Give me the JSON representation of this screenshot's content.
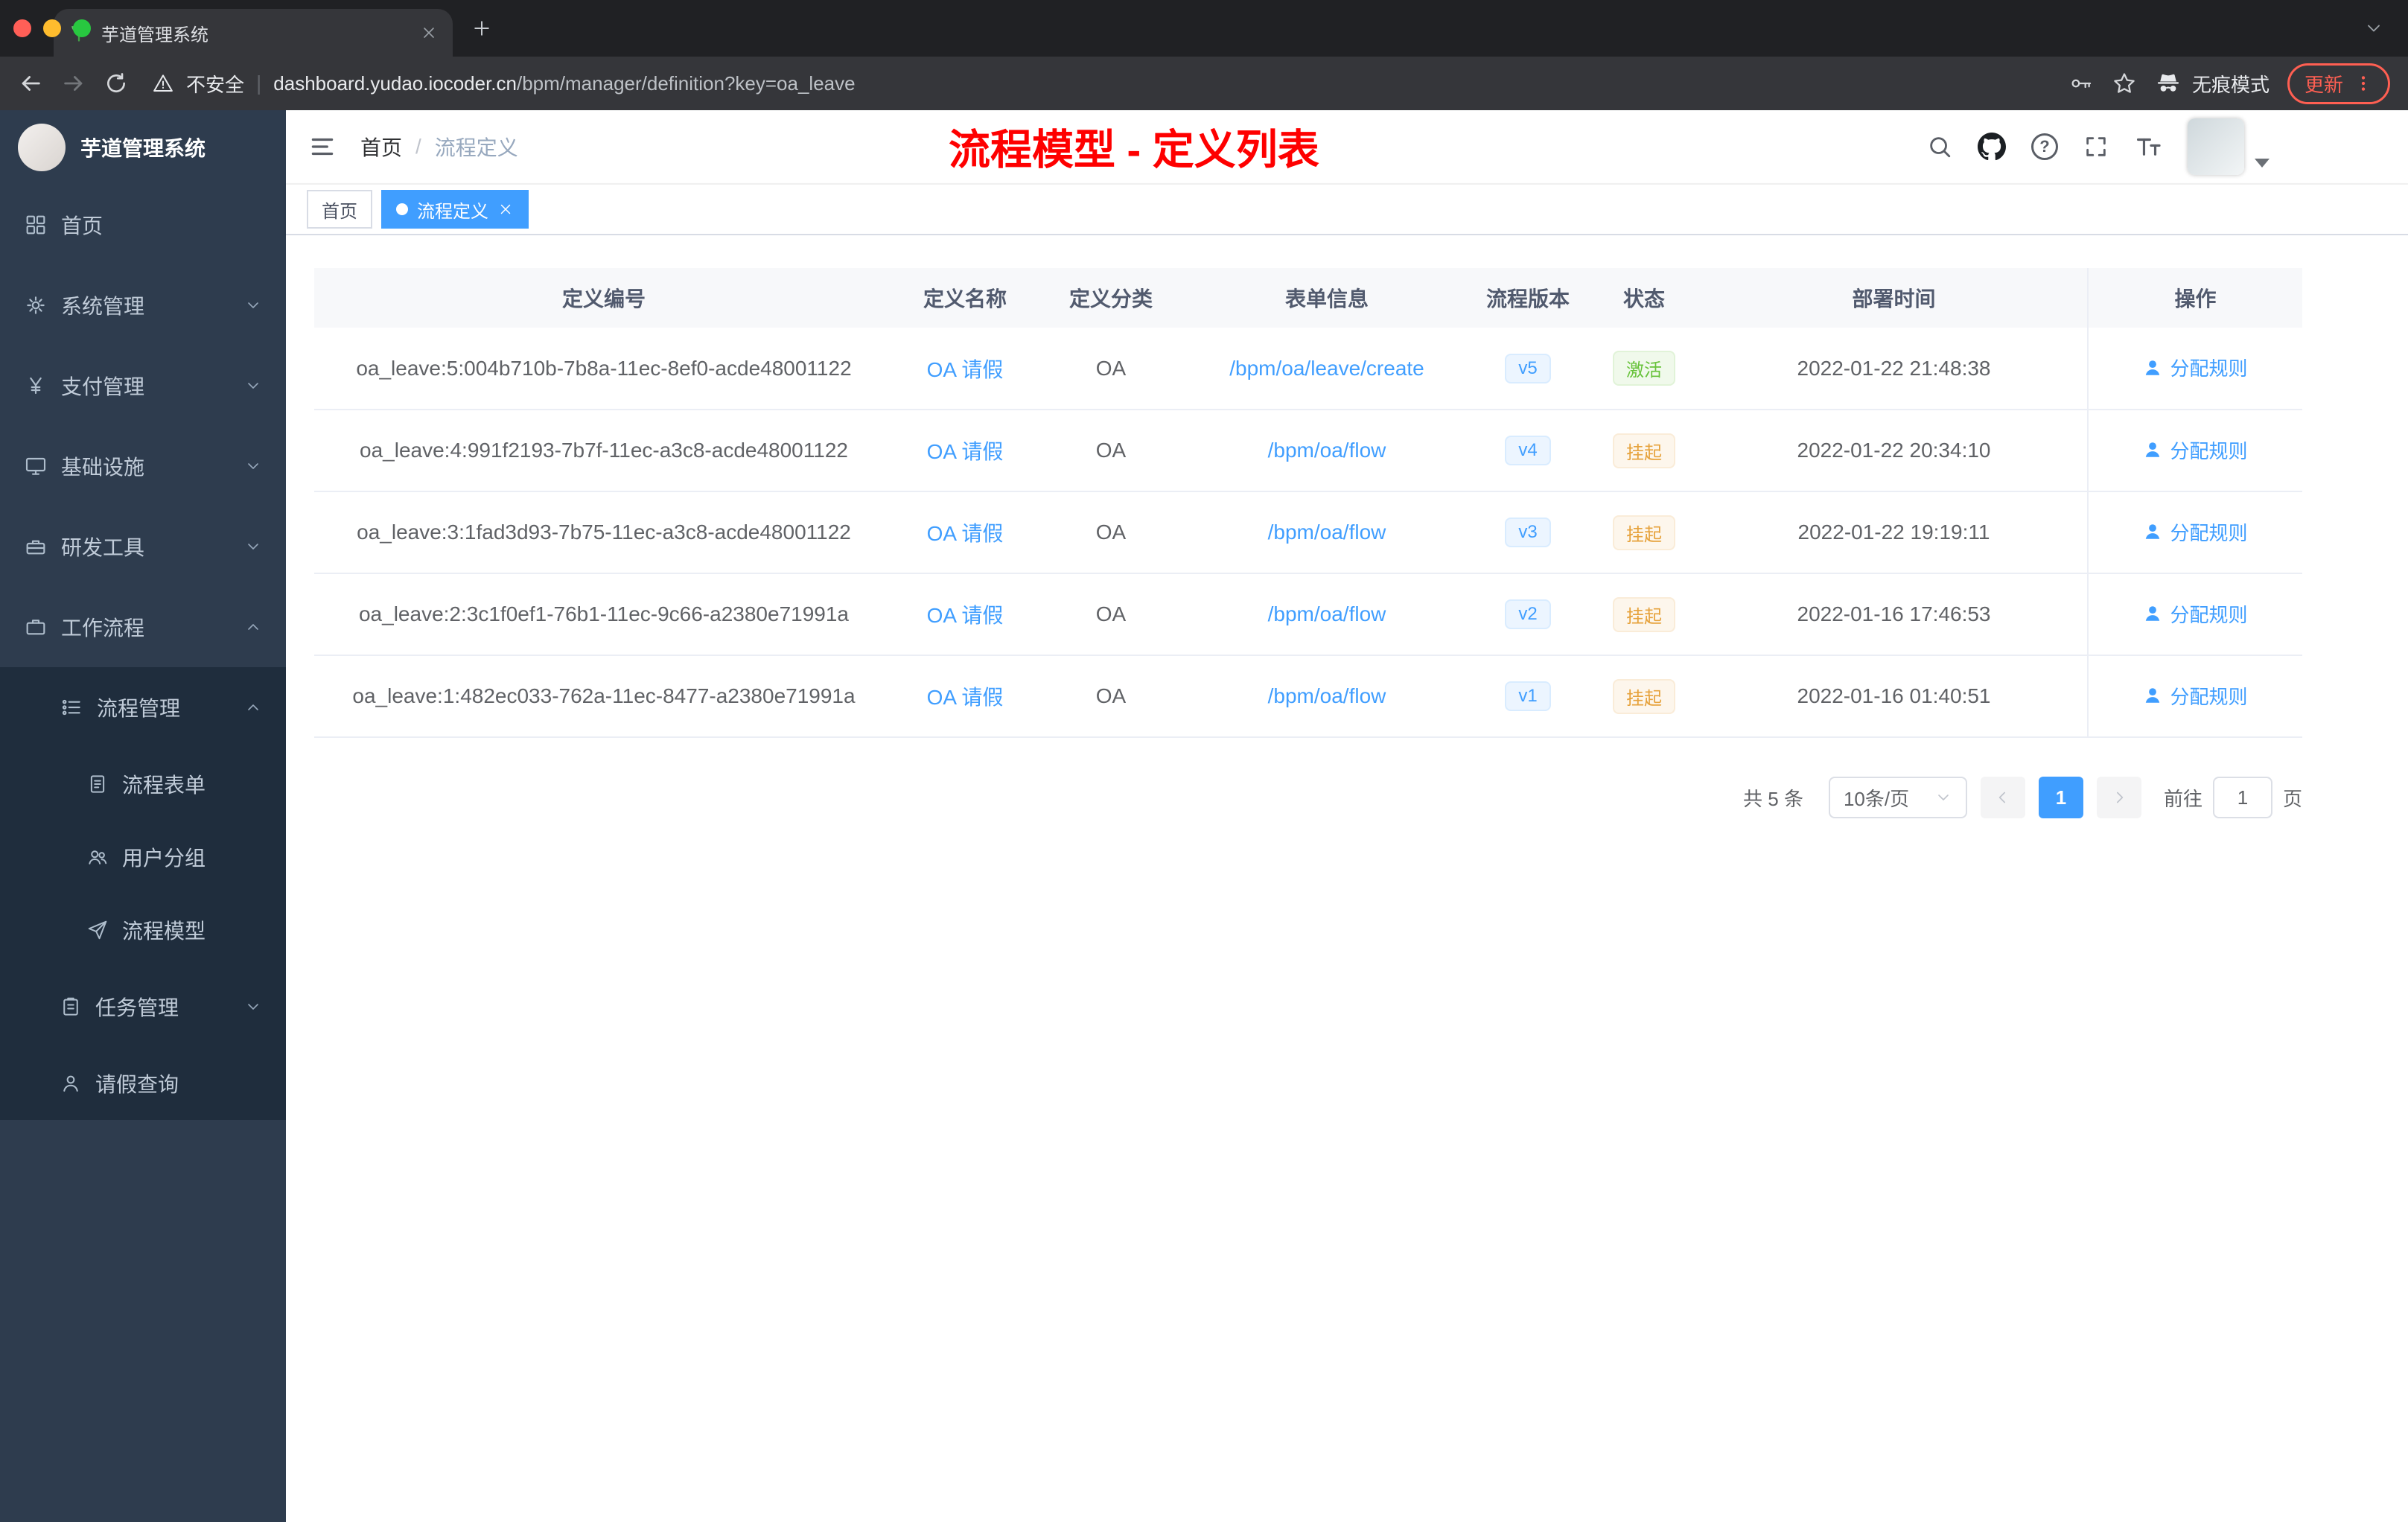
{
  "theme": {
    "accent_blue": "#409eff",
    "sidebar_bg": "#2e3c4e",
    "submenu_bg": "#1f2d3d",
    "status_active_color": "#67c23a",
    "status_suspend_color": "#e6a23c",
    "overlay_red": "#fe0000"
  },
  "browser": {
    "tab_title": "芋道管理系统",
    "security_label": "不安全",
    "url_domain": "dashboard.yudao.iocoder.cn",
    "url_path": "/bpm/manager/definition?key=oa_leave",
    "incognito_label": "无痕模式",
    "update_label": "更新"
  },
  "sidebar": {
    "logo_title": "芋道管理系统",
    "items": [
      {
        "label": "首页"
      },
      {
        "label": "系统管理"
      },
      {
        "label": "支付管理"
      },
      {
        "label": "基础设施"
      },
      {
        "label": "研发工具"
      },
      {
        "label": "工作流程"
      },
      {
        "label": "流程管理"
      },
      {
        "label": "流程表单"
      },
      {
        "label": "用户分组"
      },
      {
        "label": "流程模型"
      },
      {
        "label": "任务管理"
      },
      {
        "label": "请假查询"
      }
    ]
  },
  "header": {
    "breadcrumb_home": "首页",
    "breadcrumb_separator": "/",
    "breadcrumb_current": "流程定义",
    "overlay_title": "流程模型 - 定义列表"
  },
  "tags": {
    "home": "首页",
    "active": "流程定义"
  },
  "table": {
    "columns": [
      "定义编号",
      "定义名称",
      "定义分类",
      "表单信息",
      "流程版本",
      "状态",
      "部署时间",
      "操作"
    ],
    "action_label": "分配规则",
    "rows": [
      {
        "id": "oa_leave:5:004b710b-7b8a-11ec-8ef0-acde48001122",
        "name": "OA 请假",
        "category": "OA",
        "form": "/bpm/oa/leave/create",
        "version": "v5",
        "status": "激活",
        "time": "2022-01-22 21:48:38"
      },
      {
        "id": "oa_leave:4:991f2193-7b7f-11ec-a3c8-acde48001122",
        "name": "OA 请假",
        "category": "OA",
        "form": "/bpm/oa/flow",
        "version": "v4",
        "status": "挂起",
        "time": "2022-01-22 20:34:10"
      },
      {
        "id": "oa_leave:3:1fad3d93-7b75-11ec-a3c8-acde48001122",
        "name": "OA 请假",
        "category": "OA",
        "form": "/bpm/oa/flow",
        "version": "v3",
        "status": "挂起",
        "time": "2022-01-22 19:19:11"
      },
      {
        "id": "oa_leave:2:3c1f0ef1-76b1-11ec-9c66-a2380e71991a",
        "name": "OA 请假",
        "category": "OA",
        "form": "/bpm/oa/flow",
        "version": "v2",
        "status": "挂起",
        "time": "2022-01-16 17:46:53"
      },
      {
        "id": "oa_leave:1:482ec033-762a-11ec-8477-a2380e71991a",
        "name": "OA 请假",
        "category": "OA",
        "form": "/bpm/oa/flow",
        "version": "v1",
        "status": "挂起",
        "time": "2022-01-16 01:40:51"
      }
    ]
  },
  "pagination": {
    "total": "共 5 条",
    "page_size": "10条/页",
    "current_page": "1",
    "goto_label": "前往",
    "goto_value": "1",
    "page_unit": "页"
  }
}
